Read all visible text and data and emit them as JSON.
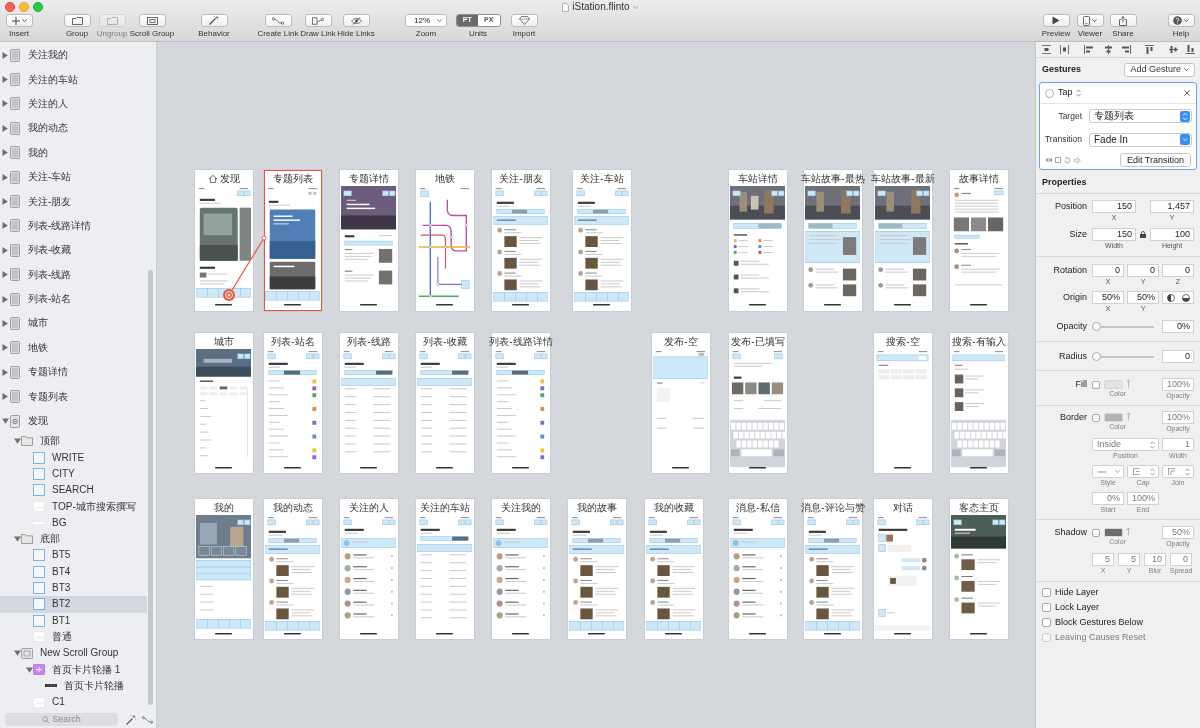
{
  "window": {
    "title": "iStation.flinto"
  },
  "toolbar": {
    "left": [
      {
        "label": "Insert",
        "kind": "button",
        "disabled": false
      },
      {
        "label": "Group",
        "kind": "button",
        "disabled": false
      },
      {
        "label": "Ungroup",
        "kind": "button",
        "disabled": true
      },
      {
        "label": "Scroll Group",
        "kind": "button",
        "disabled": false
      },
      {
        "label": "Behavior",
        "kind": "button",
        "disabled": false
      },
      {
        "label": "Create Link",
        "kind": "button",
        "disabled": false
      },
      {
        "label": "Draw Link",
        "kind": "button",
        "disabled": false
      },
      {
        "label": "Hide Links",
        "kind": "button",
        "disabled": false
      },
      {
        "label": "Zoom",
        "kind": "dropdown",
        "value": "12%"
      },
      {
        "label": "Units",
        "kind": "segmented",
        "options": [
          {
            "label": "PT",
            "selected": true
          },
          {
            "label": "PX",
            "selected": false
          }
        ]
      },
      {
        "label": "Import",
        "kind": "button",
        "disabled": false
      }
    ],
    "right": [
      {
        "label": "Preview",
        "kind": "button",
        "disabled": false
      },
      {
        "label": "Viewer",
        "kind": "button",
        "disabled": false
      },
      {
        "label": "Share",
        "kind": "button",
        "disabled": false
      },
      {
        "label": "Help",
        "kind": "button",
        "disabled": false
      }
    ]
  },
  "layers": {
    "items": [
      {
        "label": "关注我的",
        "kind": "artboard",
        "expanded": false,
        "selected": false
      },
      {
        "label": "关注的车站",
        "kind": "artboard",
        "expanded": false,
        "selected": false
      },
      {
        "label": "关注的人",
        "kind": "artboard",
        "expanded": false,
        "selected": false
      },
      {
        "label": "我的动态",
        "kind": "artboard",
        "expanded": false,
        "selected": false
      },
      {
        "label": "我的",
        "kind": "artboard",
        "expanded": false,
        "selected": false
      },
      {
        "label": "关注-车站",
        "kind": "artboard",
        "expanded": false,
        "selected": false
      },
      {
        "label": "关注-朋友",
        "kind": "artboard",
        "expanded": false,
        "selected": false
      },
      {
        "label": "列表-线路详情",
        "kind": "artboard",
        "expanded": false,
        "selected": false
      },
      {
        "label": "列表-收藏",
        "kind": "artboard",
        "expanded": false,
        "selected": false
      },
      {
        "label": "列表-线路",
        "kind": "artboard",
        "expanded": false,
        "selected": false
      },
      {
        "label": "列表-站名",
        "kind": "artboard",
        "expanded": false,
        "selected": false
      },
      {
        "label": "城市",
        "kind": "artboard",
        "expanded": false,
        "selected": false
      },
      {
        "label": "地铁",
        "kind": "artboard",
        "expanded": false,
        "selected": false
      },
      {
        "label": "专题详情",
        "kind": "artboard",
        "expanded": false,
        "selected": false
      },
      {
        "label": "专题列表",
        "kind": "artboard",
        "expanded": false,
        "selected": false
      },
      {
        "label": "发现",
        "kind": "start",
        "expanded": true,
        "selected": false,
        "children": [
          {
            "label": "顶部",
            "kind": "folder",
            "expanded": true,
            "selected": false,
            "children": [
              {
                "label": "WRITE",
                "kind": "rect",
                "selected": false
              },
              {
                "label": "CITY",
                "kind": "rect",
                "selected": false
              },
              {
                "label": "SEARCH",
                "kind": "rect",
                "selected": false
              },
              {
                "label": "TOP-城市搜索撰写",
                "kind": "image",
                "selected": false
              },
              {
                "label": "BG",
                "kind": "line",
                "selected": false
              }
            ]
          },
          {
            "label": "底部",
            "kind": "folder",
            "expanded": true,
            "selected": false,
            "children": [
              {
                "label": "BT5",
                "kind": "rect",
                "selected": false
              },
              {
                "label": "BT4",
                "kind": "rect",
                "selected": false
              },
              {
                "label": "BT3",
                "kind": "rect",
                "selected": false
              },
              {
                "label": "BT2",
                "kind": "rect",
                "selected": true
              },
              {
                "label": "BT1",
                "kind": "rect",
                "selected": false
              },
              {
                "label": "普通",
                "kind": "image",
                "selected": false
              }
            ]
          },
          {
            "label": "New Scroll Group",
            "kind": "scroll",
            "expanded": true,
            "selected": false,
            "children": [
              {
                "label": "首页卡片轮播 1",
                "kind": "component",
                "expanded": true,
                "selected": false,
                "children": [
                  {
                    "label": "首页卡片轮播",
                    "kind": "strip",
                    "selected": false
                  }
                ]
              },
              {
                "label": "C1",
                "kind": "image",
                "selected": false
              }
            ]
          }
        ]
      }
    ],
    "search": {
      "placeholder": "Search"
    }
  },
  "canvas": {
    "rows": [
      {
        "artboards": [
          {
            "title": "发现",
            "kind": "home",
            "home": true,
            "selected": false,
            "linked": true
          },
          {
            "title": "专题列表",
            "kind": "cards",
            "home": false,
            "selected": true,
            "linked": false
          },
          {
            "title": "专题详情",
            "kind": "article",
            "home": false,
            "selected": false,
            "linked": false
          },
          {
            "title": "地铁",
            "kind": "subway",
            "home": false,
            "selected": false,
            "linked": false
          },
          {
            "title": "关注-朋友",
            "kind": "feed",
            "home": false,
            "selected": false,
            "linked": false
          },
          {
            "title": "关注-车站",
            "kind": "feed",
            "home": false,
            "selected": false,
            "linked": false
          },
          {
            "title": "车站详情",
            "kind": "station",
            "home": false,
            "selected": false,
            "linked": false
          },
          {
            "title": "车站故事-最热",
            "kind": "storylist",
            "home": false,
            "selected": false,
            "linked": false
          },
          {
            "title": "车站故事-最新",
            "kind": "storylist",
            "home": false,
            "selected": false,
            "linked": false
          },
          {
            "title": "故事详情",
            "kind": "story",
            "home": false,
            "selected": false,
            "linked": false
          }
        ]
      },
      {
        "artboards": [
          {
            "title": "城市",
            "kind": "city",
            "home": false,
            "selected": false,
            "linked": false
          },
          {
            "title": "列表-站名",
            "kind": "index",
            "home": false,
            "selected": false,
            "linked": false
          },
          {
            "title": "列表-线路",
            "kind": "list",
            "home": false,
            "selected": false,
            "linked": false
          },
          {
            "title": "列表-收藏",
            "kind": "list",
            "home": false,
            "selected": false,
            "linked": false
          },
          {
            "title": "列表-线路详情",
            "kind": "index",
            "home": false,
            "selected": false,
            "linked": false
          },
          {
            "title": "发布-空",
            "kind": "compose",
            "home": false,
            "selected": false,
            "linked": false
          },
          {
            "title": "发布-已填写",
            "kind": "composed",
            "home": false,
            "selected": false,
            "linked": false
          },
          {
            "title": "搜索-空",
            "kind": "search",
            "home": false,
            "selected": false,
            "linked": false
          },
          {
            "title": "搜索-有输入",
            "kind": "searchkb",
            "home": false,
            "selected": false,
            "linked": false
          }
        ]
      },
      {
        "artboards": [
          {
            "title": "我的",
            "kind": "profile",
            "home": false,
            "selected": false,
            "linked": false
          },
          {
            "title": "我的动态",
            "kind": "feed",
            "home": false,
            "selected": false,
            "linked": false
          },
          {
            "title": "关注的人",
            "kind": "people",
            "home": false,
            "selected": false,
            "linked": false
          },
          {
            "title": "关注的车站",
            "kind": "list",
            "home": false,
            "selected": false,
            "linked": false
          },
          {
            "title": "关注我的",
            "kind": "people",
            "home": false,
            "selected": false,
            "linked": false
          },
          {
            "title": "我的故事",
            "kind": "feed",
            "home": false,
            "selected": false,
            "linked": false
          },
          {
            "title": "我的收藏",
            "kind": "feed",
            "home": false,
            "selected": false,
            "linked": false
          },
          {
            "title": "消息-私信",
            "kind": "people",
            "home": false,
            "selected": false,
            "linked": false
          },
          {
            "title": "消息-评论与赞",
            "kind": "feed",
            "home": false,
            "selected": false,
            "linked": false
          },
          {
            "title": "对话",
            "kind": "chat",
            "home": false,
            "selected": false,
            "linked": false
          },
          {
            "title": "客态主页",
            "kind": "guest",
            "home": false,
            "selected": false,
            "linked": false
          }
        ]
      }
    ]
  },
  "inspector": {
    "gestures": {
      "title": "Gestures",
      "add_button": "Add Gesture",
      "items": [
        {
          "trigger": "Tap",
          "target_label": "Target",
          "target": "专题列表",
          "transition_label": "Transition",
          "transition": "Fade In",
          "edit_button": "Edit Transition"
        }
      ]
    },
    "properties": {
      "title": "Properties",
      "rows": [
        {
          "kind": "fields",
          "label": "Position",
          "fields": [
            {
              "value": "150",
              "caption": "X"
            },
            {
              "value": "1,457",
              "caption": "Y"
            }
          ]
        },
        {
          "kind": "size",
          "label": "Size",
          "fields": [
            {
              "value": "150",
              "caption": "Width"
            },
            {
              "value": "100",
              "caption": "Height"
            }
          ]
        },
        {
          "kind": "fields",
          "label": "Rotation",
          "fields": [
            {
              "value": "0",
              "caption": "X"
            },
            {
              "value": "0",
              "caption": "Y"
            },
            {
              "value": "0",
              "caption": "Z"
            }
          ]
        },
        {
          "kind": "origin",
          "label": "Origin",
          "fields": [
            {
              "value": "50%",
              "caption": "X"
            },
            {
              "value": "50%",
              "caption": "Y"
            }
          ]
        },
        {
          "kind": "slider",
          "label": "Opacity",
          "level": 0,
          "value": "0%"
        },
        {
          "kind": "slider",
          "label": "Radius",
          "level": 0,
          "value": "0"
        },
        {
          "kind": "style",
          "label": "Fill",
          "checked": false,
          "color": "#e2e2e2",
          "color_caption": "Color",
          "opacity": "100%",
          "opacity_caption": "Opacity"
        },
        {
          "kind": "style",
          "label": "Border",
          "checked": false,
          "color": "#b3b3b3",
          "color_caption": "Color",
          "opacity": "100%",
          "opacity_caption": "Opacity",
          "extra": [
            [
              {
                "kind": "select",
                "value": "Inside",
                "caption": "Position"
              },
              {
                "kind": "field",
                "value": "1",
                "caption": "Width"
              }
            ],
            [
              {
                "kind": "icon_select",
                "caption": "Style"
              },
              {
                "kind": "icon_select",
                "caption": "Cap"
              },
              {
                "kind": "icon_select",
                "caption": "Join"
              }
            ],
            [
              {
                "kind": "field",
                "value": "0%",
                "caption": "Start"
              },
              {
                "kind": "field",
                "value": "100%",
                "caption": "End"
              }
            ]
          ]
        },
        {
          "kind": "style",
          "label": "Shadow",
          "checked": false,
          "color": "#6b6b6b",
          "color_caption": "Color",
          "opacity": "50%",
          "opacity_caption": "Opacity",
          "extra": [
            [
              {
                "kind": "field",
                "value": "5",
                "caption": "X"
              },
              {
                "kind": "field",
                "value": "5",
                "caption": "Y"
              },
              {
                "kind": "field",
                "value": "10",
                "caption": "Blur"
              },
              {
                "kind": "field",
                "value": "0",
                "caption": "Spread"
              }
            ]
          ]
        }
      ]
    },
    "options": [
      {
        "label": "Hide Layer",
        "checked": false,
        "disabled": false
      },
      {
        "label": "Lock Layer",
        "checked": false,
        "disabled": false
      },
      {
        "label": "Block Gestures Below",
        "checked": false,
        "disabled": false
      },
      {
        "label": "Leaving Causes Reset",
        "checked": false,
        "disabled": true
      }
    ]
  }
}
